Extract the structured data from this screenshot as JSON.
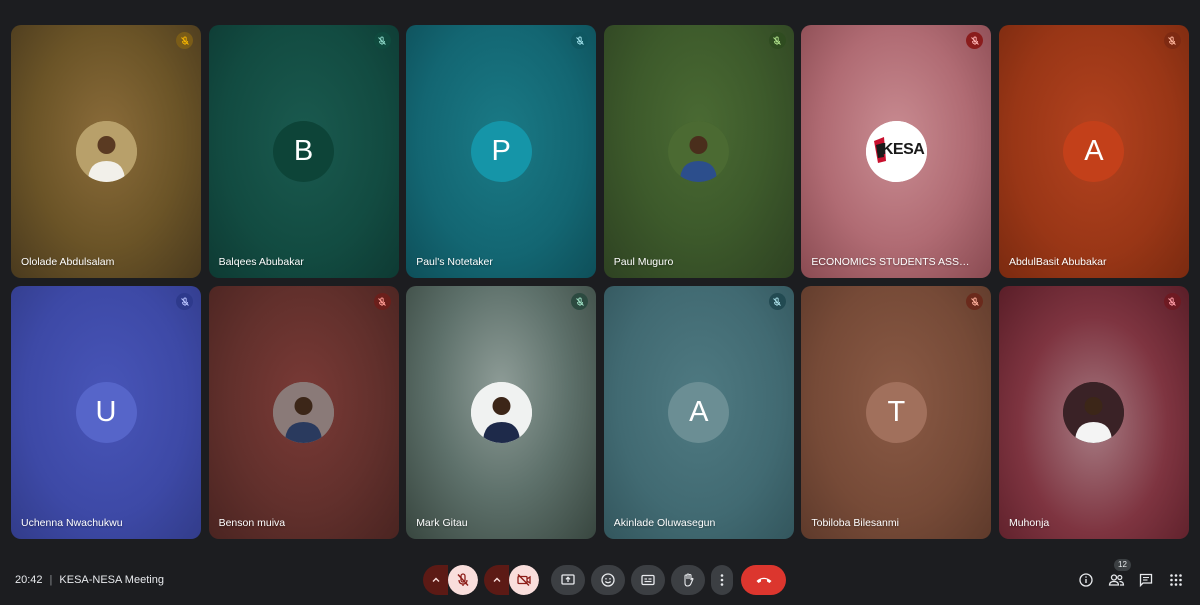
{
  "meeting": {
    "time": "20:42",
    "separator": "|",
    "title": "KESA-NESA Meeting",
    "participant_count": "12"
  },
  "participants": [
    {
      "name": "Ololade Abdulsalam",
      "avatar_type": "photo",
      "initial": "",
      "bg": "radial-gradient(ellipse at 50% 45%, #8b6c3a 0%, #6b5427 55%, #4a3a1e 100%)",
      "avatar_bg": "#a89462",
      "mic_bg": "#7a5c18",
      "mic_color": "#f5b400"
    },
    {
      "name": "Balqees Abubakar",
      "avatar_type": "initial",
      "initial": "B",
      "bg": "radial-gradient(ellipse at 50% 45%, #1a5a4f 0%, #124b41 60%, #0e3a33 100%)",
      "avatar_bg": "#0d4438",
      "mic_bg": "#0f4a3e",
      "mic_color": "#8ad4c4"
    },
    {
      "name": "Paul's Notetaker",
      "avatar_type": "initial",
      "initial": "P",
      "bg": "radial-gradient(ellipse at 50% 45%, #1a7a86 0%, #136672 60%, #0e4f59 100%)",
      "avatar_bg": "#1595a8",
      "mic_bg": "#0f5862",
      "mic_color": "#9fe0ea"
    },
    {
      "name": "Paul Muguro",
      "avatar_type": "photo",
      "initial": "",
      "bg": "radial-gradient(ellipse at 50% 40%, #4a6a33 0%, #3d5a2b 50%, #2e4222 100%)",
      "avatar_bg": "#3e5e2a",
      "mic_bg": "#2f4c20",
      "mic_color": "#aee08a"
    },
    {
      "name": "ECONOMICS STUDENTS ASSOCIATION",
      "avatar_type": "logo",
      "initial": "",
      "bg": "radial-gradient(ellipse at 50% 45%, #c98c92 0%, #b06b73 55%, #8a4b52 100%)",
      "avatar_bg": "#ffffff",
      "mic_bg": "#8a1c1c",
      "mic_color": "#ffb4b4"
    },
    {
      "name": "AbdulBasit Abubakar",
      "avatar_type": "initial",
      "initial": "A",
      "bg": "radial-gradient(ellipse at 50% 45%, #b3421f 0%, #993616 60%, #7a2a10 100%)",
      "avatar_bg": "#c3401a",
      "mic_bg": "#7e2a12",
      "mic_color": "#ffb59c"
    },
    {
      "name": "Uchenna Nwachukwu",
      "avatar_type": "initial",
      "initial": "U",
      "bg": "radial-gradient(ellipse at 50% 45%, #4855b8 0%, #3d49a6 60%, #323c8a 100%)",
      "avatar_bg": "#5665c9",
      "mic_bg": "#2e3a8c",
      "mic_color": "#b9c3ff"
    },
    {
      "name": "Benson muiva",
      "avatar_type": "photo",
      "initial": "",
      "bg": "radial-gradient(ellipse at 50% 45%, #7a3a36 0%, #62302c 55%, #4a2421 100%)",
      "avatar_bg": "#8a7a78",
      "mic_bg": "#6b1f1b",
      "mic_color": "#ff9c94"
    },
    {
      "name": "Mark Gitau",
      "avatar_type": "photo",
      "initial": "",
      "bg": "radial-gradient(ellipse at 50% 40%, #8e9c97 0%, #5e716b 50%, #38463f 100%)",
      "avatar_bg": "#e8ecea",
      "mic_bg": "#2c4a40",
      "mic_color": "#9fe0c4"
    },
    {
      "name": "Akinlade Oluwasegun",
      "avatar_type": "initial",
      "initial": "A",
      "bg": "radial-gradient(ellipse at 50% 45%, #4f7a82 0%, #416a72 60%, #33565d 100%)",
      "avatar_bg": "#6b8e94",
      "mic_bg": "#224a52",
      "mic_color": "#a8dde6"
    },
    {
      "name": "Tobiloba Bilesanmi",
      "avatar_type": "initial",
      "initial": "T",
      "bg": "radial-gradient(ellipse at 50% 45%, #8a5a45 0%, #764a37 60%, #5e3a2b 100%)",
      "avatar_bg": "#a1705c",
      "mic_bg": "#6a2a1c",
      "mic_color": "#ffb09c"
    },
    {
      "name": "Muhonja",
      "avatar_type": "photo",
      "initial": "",
      "bg": "radial-gradient(ellipse at 50% 55%, #a67a82 0%, #7e3440 55%, #5a1e28 100%)",
      "avatar_bg": "#4a2a2e",
      "mic_bg": "#6e1a22",
      "mic_color": "#ff9ca6"
    }
  ],
  "logo_text": "KESA",
  "colors": {
    "hangup": "#dc362e",
    "muted_fill": "#f9dedc",
    "muted_icon": "#b3261e"
  }
}
